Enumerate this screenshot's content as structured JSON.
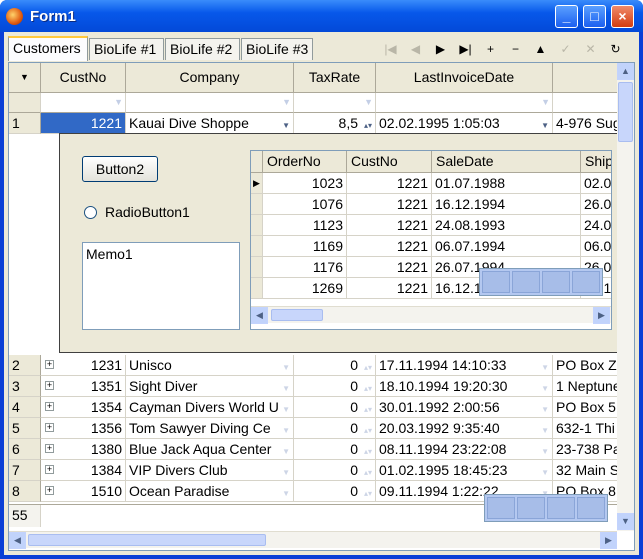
{
  "window": {
    "title": "Form1",
    "min": "_",
    "max": "□",
    "close": "×"
  },
  "tabs": [
    "Customers",
    "BioLife #1",
    "BioLife #2",
    "BioLife #3"
  ],
  "navigator": [
    {
      "icon": "first-record-icon",
      "glyph": "|◀",
      "enabled": false
    },
    {
      "icon": "prior-record-icon",
      "glyph": "◀",
      "enabled": false
    },
    {
      "icon": "next-record-icon",
      "glyph": "▶",
      "enabled": true
    },
    {
      "icon": "last-record-icon",
      "glyph": "▶|",
      "enabled": true
    },
    {
      "icon": "insert-record-icon",
      "glyph": "+",
      "enabled": true
    },
    {
      "icon": "delete-record-icon",
      "glyph": "−",
      "enabled": true
    },
    {
      "icon": "edit-record-icon",
      "glyph": "▲",
      "enabled": true
    },
    {
      "icon": "post-record-icon",
      "glyph": "✓",
      "enabled": false
    },
    {
      "icon": "cancel-record-icon",
      "glyph": "✕",
      "enabled": false
    },
    {
      "icon": "refresh-icon",
      "glyph": "↻",
      "enabled": true
    }
  ],
  "grid": {
    "indicator_header": "▼",
    "columns": [
      "CustNo",
      "Company",
      "TaxRate",
      "LastInvoiceDate"
    ],
    "rows": [
      {
        "no": "1",
        "cust": "1221",
        "company": "Kauai Dive Shoppe",
        "tax": "8,5",
        "date": "02.02.1995 1:05:03",
        "addr": "4-976 Sug"
      },
      {
        "no": "2",
        "cust": "1231",
        "company": "Unisco",
        "tax": "0",
        "date": "17.11.1994 14:10:33",
        "addr": "PO Box Z"
      },
      {
        "no": "3",
        "cust": "1351",
        "company": "Sight Diver",
        "tax": "0",
        "date": "18.10.1994 19:20:30",
        "addr": "1 Neptune"
      },
      {
        "no": "4",
        "cust": "1354",
        "company": "Cayman Divers World U",
        "tax": "0",
        "date": "30.01.1992 2:00:56",
        "addr": "PO Box 5"
      },
      {
        "no": "5",
        "cust": "1356",
        "company": "Tom Sawyer Diving Ce",
        "tax": "0",
        "date": "20.03.1992 9:35:40",
        "addr": "632-1 Thi"
      },
      {
        "no": "6",
        "cust": "1380",
        "company": "Blue Jack Aqua Center",
        "tax": "0",
        "date": "08.11.1994 23:22:08",
        "addr": "23-738 Pa"
      },
      {
        "no": "7",
        "cust": "1384",
        "company": "VIP Divers Club",
        "tax": "0",
        "date": "01.02.1995 18:45:23",
        "addr": "32 Main S"
      },
      {
        "no": "8",
        "cust": "1510",
        "company": "Ocean Paradise",
        "tax": "0",
        "date": "09.11.1994 1:22:22",
        "addr": "PO Box 8"
      }
    ],
    "footer_count": "55"
  },
  "detail": {
    "button": "Button2",
    "radio": "RadioButton1",
    "memo": "Memo1",
    "subgrid": {
      "columns": [
        "OrderNo",
        "CustNo",
        "SaleDate",
        "Ship"
      ],
      "rows": [
        [
          "1023",
          "1221",
          "01.07.1988",
          "02.0"
        ],
        [
          "1076",
          "1221",
          "16.12.1994",
          "26.0"
        ],
        [
          "1123",
          "1221",
          "24.08.1993",
          "24.0"
        ],
        [
          "1169",
          "1221",
          "06.07.1994",
          "06.0"
        ],
        [
          "1176",
          "1221",
          "26.07.1994",
          "26.0"
        ],
        [
          "1269",
          "1221",
          "16.12.1",
          "16.1"
        ]
      ]
    }
  }
}
